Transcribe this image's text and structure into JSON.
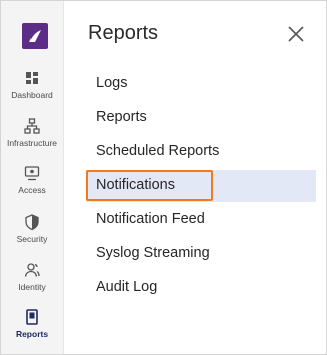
{
  "rail": {
    "items": [
      {
        "label": "Dashboard",
        "icon": "dashboard-icon"
      },
      {
        "label": "Infrastructure",
        "icon": "infrastructure-icon"
      },
      {
        "label": "Access",
        "icon": "access-icon"
      },
      {
        "label": "Security",
        "icon": "security-icon"
      },
      {
        "label": "Identity",
        "icon": "identity-icon"
      },
      {
        "label": "Reports",
        "icon": "reports-icon",
        "active": true
      }
    ]
  },
  "panel": {
    "title": "Reports",
    "items": [
      {
        "label": "Logs"
      },
      {
        "label": "Reports"
      },
      {
        "label": "Scheduled Reports"
      },
      {
        "label": "Notifications",
        "selected": true
      },
      {
        "label": "Notification Feed"
      },
      {
        "label": "Syslog Streaming"
      },
      {
        "label": "Audit Log"
      }
    ]
  },
  "colors": {
    "brand": "#5b2d86",
    "highlight_border": "#f07a1f",
    "selected_bg": "#e3e8f6"
  }
}
